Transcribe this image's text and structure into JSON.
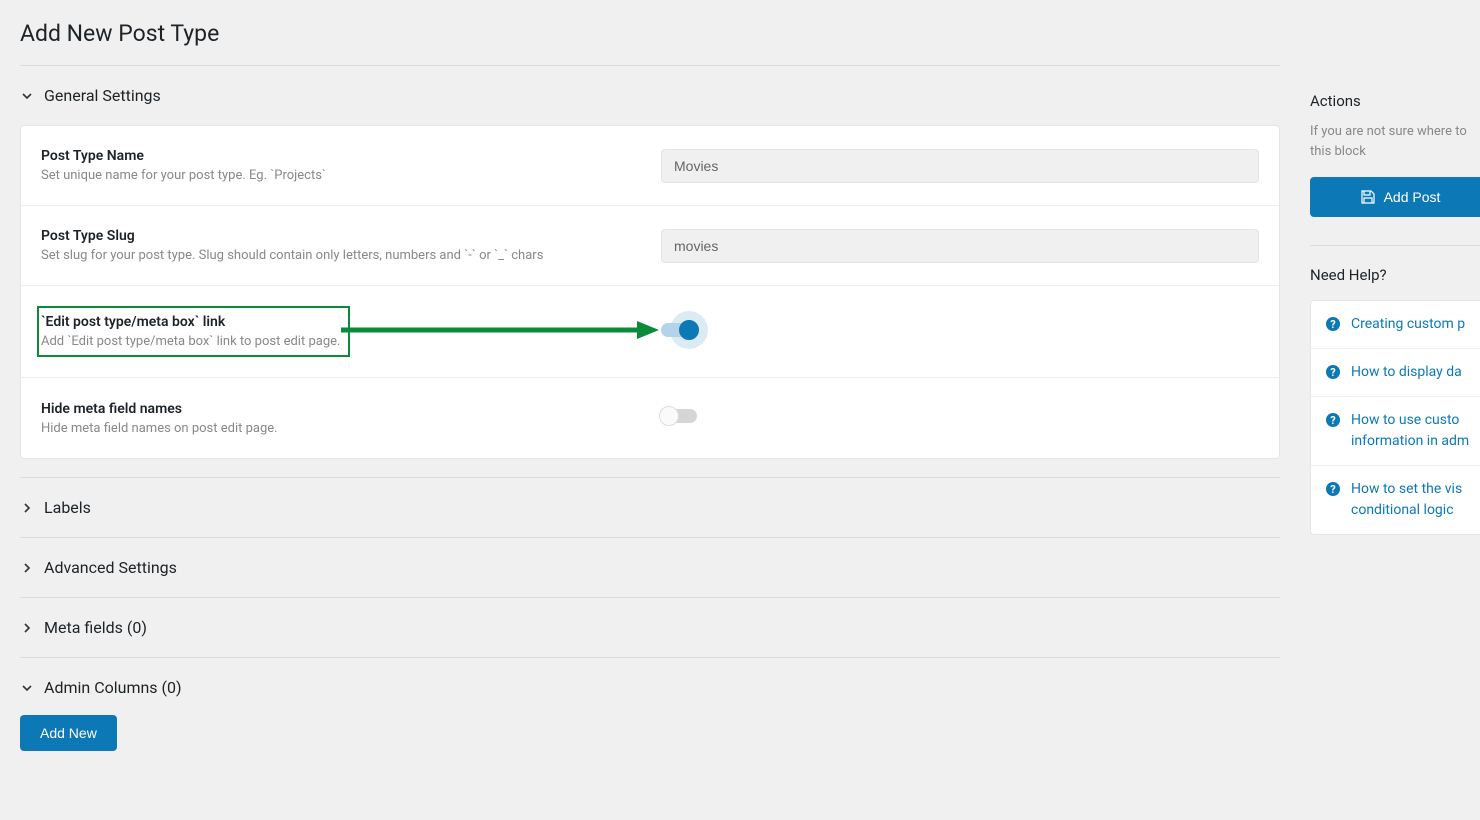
{
  "page": {
    "title": "Add New Post Type"
  },
  "sections": {
    "general": {
      "title": "General Settings",
      "expanded": true,
      "fields": {
        "name": {
          "label": "Post Type Name",
          "desc": "Set unique name for your post type. Eg. `Projects`",
          "value": "Movies"
        },
        "slug": {
          "label": "Post Type Slug",
          "desc": "Set slug for your post type. Slug should contain only letters, numbers and `-` or `_` chars",
          "value": "movies"
        },
        "edit_link": {
          "label": "`Edit post type/meta box` link",
          "desc": "Add `Edit post type/meta box` link to post edit page.",
          "on": true
        },
        "hide_meta": {
          "label": "Hide meta field names",
          "desc": "Hide meta field names on post edit page.",
          "on": false
        }
      }
    },
    "labels": {
      "title": "Labels",
      "expanded": false
    },
    "advanced": {
      "title": "Advanced Settings",
      "expanded": false
    },
    "meta_fields": {
      "title": "Meta fields (0)",
      "expanded": false
    },
    "admin_columns": {
      "title": "Admin Columns (0)",
      "expanded": true,
      "add_button": "Add New"
    }
  },
  "sidebar": {
    "actions": {
      "title": "Actions",
      "desc": "If you are not sure where to this block",
      "button": "Add Post"
    },
    "help": {
      "title": "Need Help?",
      "links": [
        "Creating custom p",
        "How to display da",
        "How to use custo information in adm",
        "How to set the vis conditional logic"
      ]
    }
  },
  "colors": {
    "primary": "#0d78b6",
    "highlight": "#0b8a3a"
  }
}
